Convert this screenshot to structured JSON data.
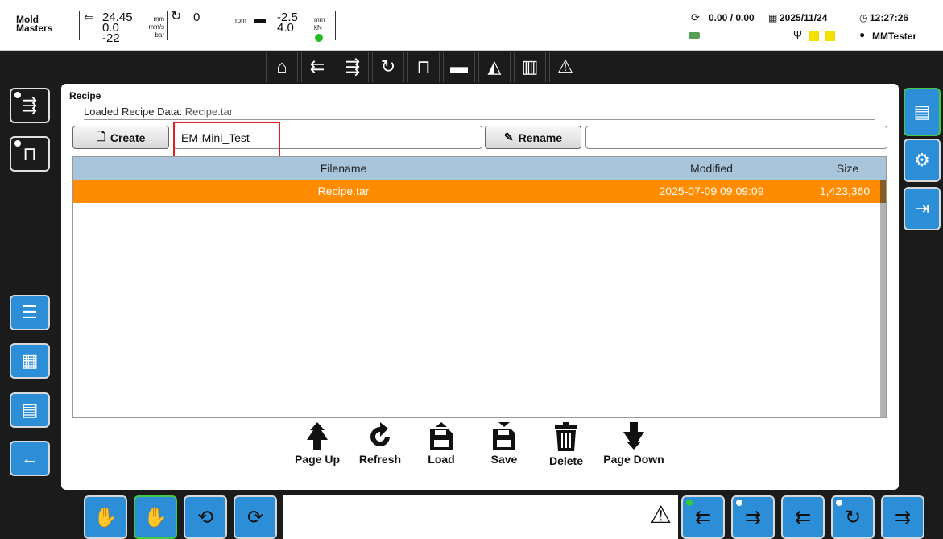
{
  "header": {
    "brand_line1": "Mold",
    "brand_line2": "Masters",
    "inj_pos": "24.45",
    "inj_speed": "0.0",
    "inj_pressure": "-22",
    "unit_mm": "mm",
    "unit_mms": "mm/s",
    "unit_bar": "bar",
    "screw_rpm": "0",
    "unit_rpm": "rpm",
    "clamp_pos": "-2.5",
    "clamp_force": "4.0",
    "unit_mm2": "mm",
    "unit_kn": "kN",
    "cycle_counter": "0.00 / 0.00",
    "date": "2025/11/24",
    "time": "12:27:26",
    "user": "MMTester"
  },
  "panel": {
    "title": "Recipe",
    "loaded_label": "Loaded Recipe Data:",
    "loaded_value": "Recipe.tar",
    "create_label": "Create",
    "create_value": "EM-Mini_Test",
    "rename_label": "Rename",
    "rename_value": ""
  },
  "table": {
    "columns": [
      "Filename",
      "Modified",
      "Size"
    ],
    "rows": [
      {
        "filename": "Recipe.tar",
        "modified": "2025-07-09 09:09:09",
        "size": "1,423,360"
      }
    ]
  },
  "actions": {
    "page_up": "Page Up",
    "refresh": "Refresh",
    "load": "Load",
    "save": "Save",
    "delete": "Delete",
    "page_down": "Page Down"
  },
  "colors": {
    "accent_blue": "#2b8ed7",
    "selected_row": "#ff8c00",
    "table_header": "#a9c5dc",
    "active_border": "#45c845",
    "highlight_box": "#e02020"
  }
}
